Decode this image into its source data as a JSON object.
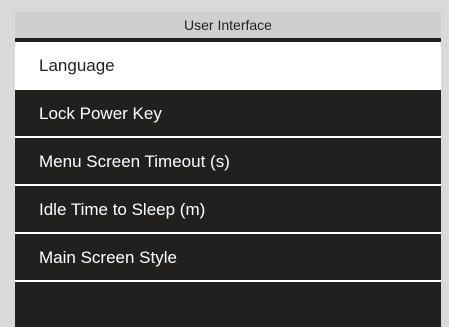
{
  "screen": {
    "title": "User Interface"
  },
  "menu": {
    "items": [
      {
        "label": "Language",
        "selected": true
      },
      {
        "label": "Lock Power Key",
        "selected": false
      },
      {
        "label": "Menu Screen Timeout (s)",
        "selected": false
      },
      {
        "label": "Idle Time to Sleep (m)",
        "selected": false
      },
      {
        "label": "Main Screen Style",
        "selected": false
      }
    ]
  },
  "colors": {
    "background": "#221f1f",
    "title_bar": "#cfcfcf",
    "selected_row": "#ffffff",
    "text_light": "#ffffff",
    "text_dark": "#231f20",
    "frame": "#d9d9d9"
  }
}
